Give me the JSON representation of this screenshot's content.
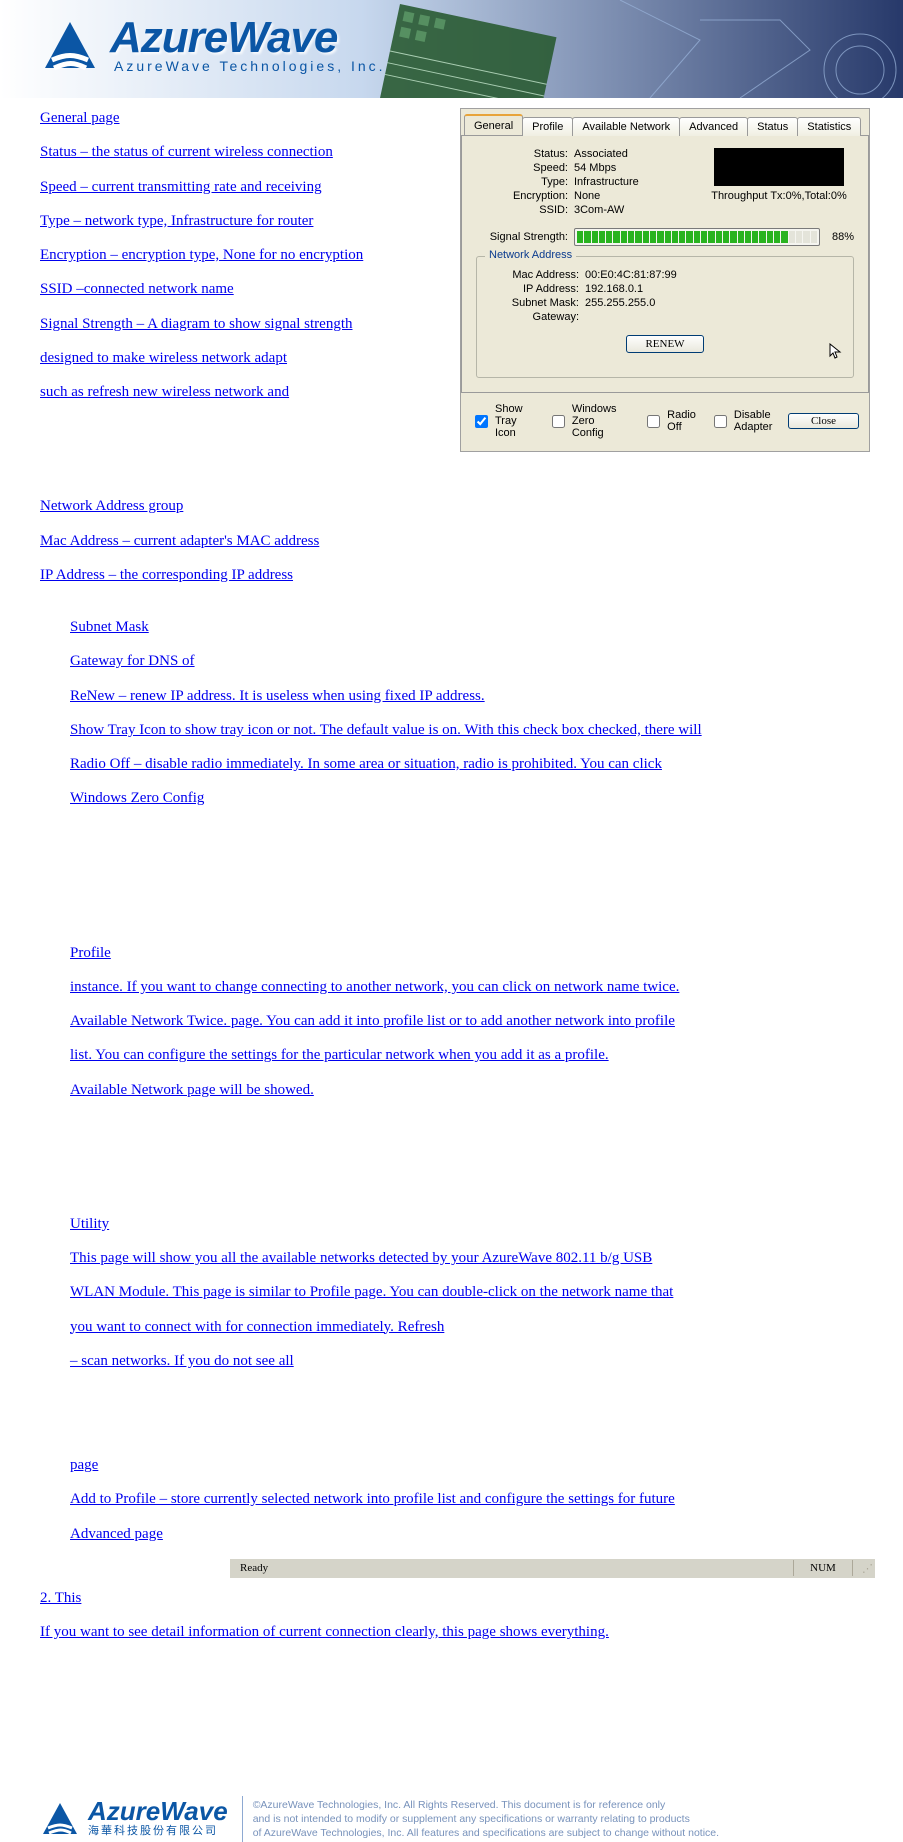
{
  "header": {
    "brand_main": "AzureWave",
    "brand_sub": "AzureWave Technologies, Inc."
  },
  "leftNav1": [
    "General page",
    "Status – the status of current wireless connection",
    "Speed – current transmitting rate and receiving",
    "Type – network type, Infrastructure for router",
    "Encryption – encryption type, None for no encryption",
    "SSID –connected network name",
    "Signal Strength – A diagram to show signal strength",
    "designed to make wireless network adapt",
    "such as refresh new wireless network and"
  ],
  "leftNav2": [
    "Network Address group",
    "Mac Address – current adapter's MAC address",
    "IP Address – the corresponding IP address"
  ],
  "panel": {
    "tabs": [
      "General",
      "Profile",
      "Available Network",
      "Advanced",
      "Status",
      "Statistics"
    ],
    "status": {
      "status_l": "Status:",
      "status_v": "Associated",
      "speed_l": "Speed:",
      "speed_v": "54 Mbps",
      "type_l": "Type:",
      "type_v": "Infrastructure",
      "enc_l": "Encryption:",
      "enc_v": "None",
      "ssid_l": "SSID:",
      "ssid_v": "3Com-AW",
      "throughput": "Throughput Tx:0%,Total:0%",
      "sig_l": "Signal Strength:",
      "sig_pct": "88%"
    },
    "net": {
      "legend": "Network Address",
      "mac_l": "Mac Address:",
      "mac_v": "00:E0:4C:81:87:99",
      "ip_l": "IP Address:",
      "ip_v": "192.168.0.1",
      "mask_l": "Subnet Mask:",
      "mask_v": "255.255.255.0",
      "gw_l": "Gateway:",
      "gw_v": ""
    },
    "renew": "RENEW",
    "options": {
      "tray": "Show Tray Icon",
      "wzc": "Windows Zero Config",
      "radio": "Radio Off",
      "dis": "Disable Adapter",
      "close": "Close"
    }
  },
  "body_lines": {
    "l1": "Subnet Mask",
    "l2": "Gateway for DNS of",
    "l3": "ReNew – renew IP address. It is useless when using fixed IP address.",
    "l4": "Show Tray Icon to show tray icon or not. The default value is on. With this check box checked, there will",
    "l5": "Radio Off – disable radio immediately. In some area or situation, radio is prohibited. You can click",
    "l6": "Windows Zero Config",
    "l7": "Profile",
    "l8": "instance. If you want to change connecting to another network, you can click on network name twice.",
    "l9": "Available Network Twice. page. You can add it into profile list or to add another network into profile",
    "l10": "list. You can configure the settings for the particular network when you add it as a profile.",
    "l11": "Available Network page will be showed."
  },
  "body2": {
    "h": "Utility",
    "a1": "This page will show you all the available networks detected by your AzureWave 802.11 b/g USB",
    "a2": "WLAN Module. This page is similar to Profile page. You can double-click on the network name that",
    "a3": "you want to connect with for connection immediately. Refresh",
    "a4": "– scan networks. If you do not see all"
  },
  "body3": {
    "h": "page",
    "b1": "Add to Profile – store currently selected network into profile list and configure the settings for future",
    "b2": "Advanced page"
  },
  "statusbar": {
    "ready": "Ready",
    "num": "NUM"
  },
  "lastlinks": {
    "c1": "2. This",
    "c2": "If you want to see detail information of current connection clearly, this page shows everything."
  },
  "footer": {
    "brand_main": "AzureWave",
    "brand_sub": "海華科技股份有限公司",
    "copy1": "©AzureWave Technologies, Inc. All Rights Reserved. This document is for reference only",
    "copy2": "and is not intended to modify or supplement any specifications or  warranty relating to products",
    "copy3": "of AzureWave Technologies, Inc.  All features and specifications are subject to change without notice."
  }
}
